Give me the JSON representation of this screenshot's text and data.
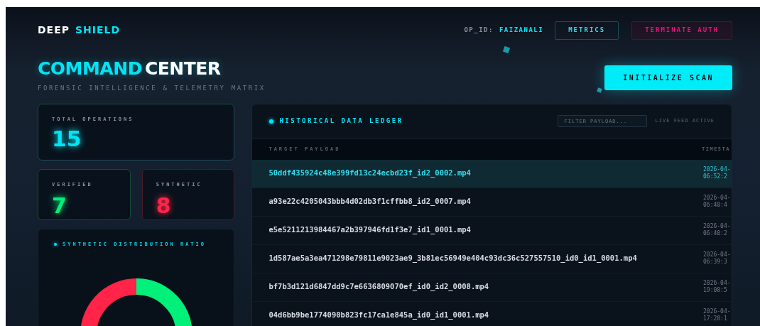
{
  "brand": {
    "first": "DEEP",
    "second": "SHIELD"
  },
  "header": {
    "op_label": "OP_ID:",
    "op_value": "FAIZANALI",
    "buttons": [
      {
        "label": "METRICS",
        "kind": "primary"
      },
      {
        "label": "TERMINATE AUTH",
        "kind": "danger"
      }
    ]
  },
  "title": {
    "first": "COMMAND",
    "second": "CENTER",
    "subtitle": "FORENSIC INTELLIGENCE & TELEMETRY MATRIX"
  },
  "scan_button": "INITIALIZE SCAN",
  "stats": [
    {
      "label": "TOTAL OPERATIONS",
      "value": "15",
      "kind": "total"
    },
    {
      "label": "VERIFIED",
      "value": "7",
      "kind": "verified"
    },
    {
      "label": "SYNTHETIC",
      "value": "8",
      "kind": "synthetic"
    }
  ],
  "distribution": {
    "title": "SYNTHETIC DISTRIBUTION RATIO"
  },
  "ledger": {
    "title": "HISTORICAL DATA LEDGER",
    "filter_placeholder": "FILTER PAYLOAD...",
    "status": "LIVE FEED ACTIVE",
    "columns": [
      "TARGET PAYLOAD",
      "TIMESTA"
    ],
    "rows": [
      {
        "payload": "50ddf435924c48e399fd13c24ecbd23f_id2_0002.mp4",
        "date": "2026-04-",
        "time": "06:52:2",
        "selected": true
      },
      {
        "payload": "a93e22c4205043bbb4d02db3f1cffbb8_id2_0007.mp4",
        "date": "2026-04-",
        "time": "06:40:4",
        "selected": false
      },
      {
        "payload": "e5e5211213984467a2b397946fd1f3e7_id1_0001.mp4",
        "date": "2026-04-",
        "time": "06:40:2",
        "selected": false
      },
      {
        "payload": "1d587ae5a3ea471298e79811e9023ae9_3b81ec56949e404c93dc36c527557510_id0_id1_0001.mp4",
        "date": "2026-04-",
        "time": "06:39:3",
        "selected": false
      },
      {
        "payload": "bf7b3d121d6847dd9c7e6636809070ef_id0_id2_0008.mp4",
        "date": "2026-04-",
        "time": "19:08:5",
        "selected": false
      },
      {
        "payload": "04d6bb9be1774090b823fc17ca1e845a_id0_id1_0001.mp4",
        "date": "2026-04-",
        "time": "17:28:1",
        "selected": false
      }
    ]
  }
}
